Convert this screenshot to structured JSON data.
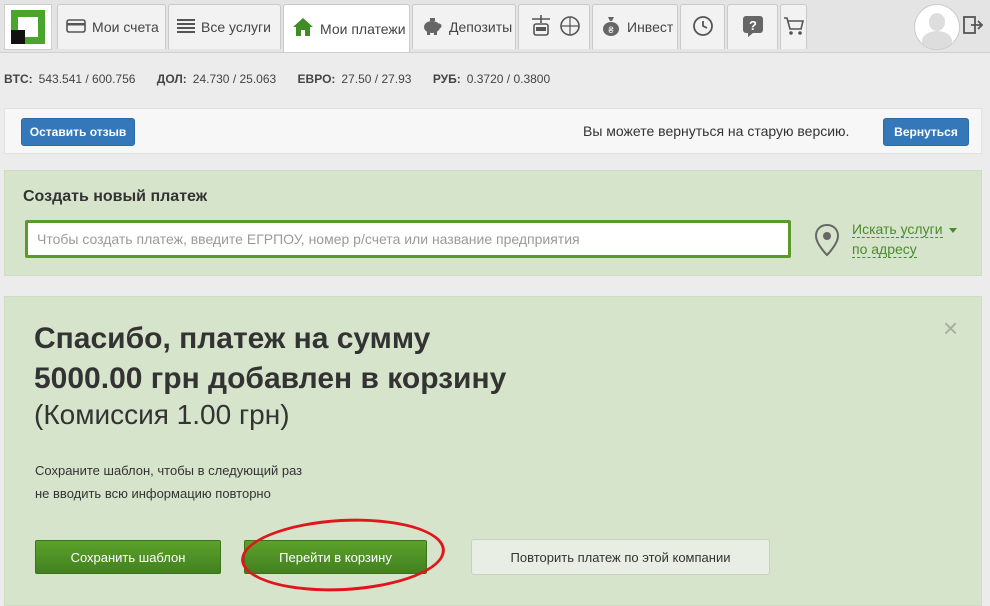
{
  "nav": {
    "tabs": [
      {
        "label": "Мои счета",
        "icon": "card-icon"
      },
      {
        "label": "Все услуги",
        "icon": "list-icon"
      },
      {
        "label": "Мои платежи",
        "icon": "home-icon"
      },
      {
        "label": "Депозиты",
        "icon": "piggy-bank-icon"
      },
      {
        "label": "",
        "icon": "travel-icon"
      },
      {
        "label": "Инвест",
        "icon": "money-bag-icon"
      },
      {
        "label": "",
        "icon": "history-icon"
      },
      {
        "label": "",
        "icon": "help-icon"
      },
      {
        "label": "",
        "icon": "cart-icon"
      }
    ]
  },
  "rates": [
    {
      "code": "BTC:",
      "value": "543.541 / 600.756"
    },
    {
      "code": "ДОЛ:",
      "value": "24.730 / 25.063"
    },
    {
      "code": "ЕВРО:",
      "value": "27.50 / 27.93"
    },
    {
      "code": "РУБ:",
      "value": "0.3720 / 0.3800"
    }
  ],
  "feedback": {
    "button": "Оставить отзыв",
    "text": "Вы можете вернуться на старую версию.",
    "return_button": "Вернуться"
  },
  "create_payment": {
    "title": "Создать новый платеж",
    "placeholder": "Чтобы создать платеж, введите ЕГРПОУ, номер р/счета или название предприятия",
    "address_link_line1": "Искать услуги",
    "address_link_line2": "по адресу"
  },
  "success": {
    "line1": "Спасибо,  платеж на сумму",
    "line2": "5000.00 грн  добавлен в корзину",
    "fee": "(Комиссия 1.00 грн)",
    "hint_line1": "Сохраните шаблон, чтобы в следующий раз",
    "hint_line2": "не вводить всю информацию повторно",
    "save_template": "Сохранить шаблон",
    "go_to_cart": "Перейти в корзину",
    "repeat_payment": "Повторить платеж по этой компании",
    "close": "×"
  },
  "colors": {
    "accent_green": "#4aa52e",
    "button_blue": "#3578b9",
    "highlight_oval": "#e0161c"
  }
}
